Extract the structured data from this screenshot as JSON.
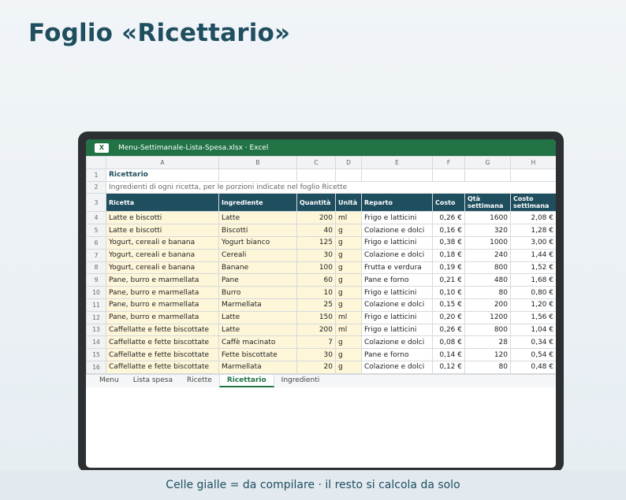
{
  "page_title": "Foglio «Ricettario»",
  "window": {
    "app_icon_letter": "X",
    "title": "Menu-Settimanale-Lista-Spesa.xlsx · Excel"
  },
  "columns": [
    "A",
    "B",
    "C",
    "D",
    "E",
    "F",
    "G",
    "H"
  ],
  "row1": {
    "num": "1",
    "text": "Ricettario"
  },
  "row2": {
    "num": "2",
    "text": "Ingredienti di ogni ricetta, per le porzioni indicate nel foglio Ricette"
  },
  "header_row": {
    "num": "3",
    "cells": [
      "Ricetta",
      "Ingrediente",
      "Quantità",
      "Unità",
      "Reparto",
      "Costo",
      "Qtà settimana",
      "Costo settimana"
    ]
  },
  "rows": [
    {
      "num": "4",
      "cells": [
        "Latte e biscotti",
        "Latte",
        "200",
        "ml",
        "Frigo e latticini",
        "0,26 €",
        "1600",
        "2,08 €"
      ]
    },
    {
      "num": "5",
      "cells": [
        "Latte e biscotti",
        "Biscotti",
        "40",
        "g",
        "Colazione e dolci",
        "0,16 €",
        "320",
        "1,28 €"
      ]
    },
    {
      "num": "6",
      "cells": [
        "Yogurt, cereali e banana",
        "Yogurt bianco",
        "125",
        "g",
        "Frigo e latticini",
        "0,38 €",
        "1000",
        "3,00 €"
      ]
    },
    {
      "num": "7",
      "cells": [
        "Yogurt, cereali e banana",
        "Cereali",
        "30",
        "g",
        "Colazione e dolci",
        "0,18 €",
        "240",
        "1,44 €"
      ]
    },
    {
      "num": "8",
      "cells": [
        "Yogurt, cereali e banana",
        "Banane",
        "100",
        "g",
        "Frutta e verdura",
        "0,19 €",
        "800",
        "1,52 €"
      ]
    },
    {
      "num": "9",
      "cells": [
        "Pane, burro e marmellata",
        "Pane",
        "60",
        "g",
        "Pane e forno",
        "0,21 €",
        "480",
        "1,68 €"
      ]
    },
    {
      "num": "10",
      "cells": [
        "Pane, burro e marmellata",
        "Burro",
        "10",
        "g",
        "Frigo e latticini",
        "0,10 €",
        "80",
        "0,80 €"
      ]
    },
    {
      "num": "11",
      "cells": [
        "Pane, burro e marmellata",
        "Marmellata",
        "25",
        "g",
        "Colazione e dolci",
        "0,15 €",
        "200",
        "1,20 €"
      ]
    },
    {
      "num": "12",
      "cells": [
        "Pane, burro e marmellata",
        "Latte",
        "150",
        "ml",
        "Frigo e latticini",
        "0,20 €",
        "1200",
        "1,56 €"
      ]
    },
    {
      "num": "13",
      "cells": [
        "Caffellatte e fette biscottate",
        "Latte",
        "200",
        "ml",
        "Frigo e latticini",
        "0,26 €",
        "800",
        "1,04 €"
      ]
    },
    {
      "num": "14",
      "cells": [
        "Caffellatte e fette biscottate",
        "Caffè macinato",
        "7",
        "g",
        "Colazione e dolci",
        "0,08 €",
        "28",
        "0,34 €"
      ]
    },
    {
      "num": "15",
      "cells": [
        "Caffellatte e fette biscottate",
        "Fette biscottate",
        "30",
        "g",
        "Pane e forno",
        "0,14 €",
        "120",
        "0,54 €"
      ]
    },
    {
      "num": "16",
      "cells": [
        "Caffellatte e fette biscottate",
        "Marmellata",
        "20",
        "g",
        "Colazione e dolci",
        "0,12 €",
        "80",
        "0,48 €"
      ]
    }
  ],
  "sheet_tabs": [
    "Menu",
    "Lista spesa",
    "Ricette",
    "Ricettario",
    "Ingredienti"
  ],
  "active_tab": "Ricettario",
  "footer_note": "Celle gialle = da compilare · il resto si calcola da solo",
  "colors": {
    "excel_green": "#217346",
    "header_teal": "#1f4e5f",
    "input_yellow": "#fdf6d9"
  }
}
